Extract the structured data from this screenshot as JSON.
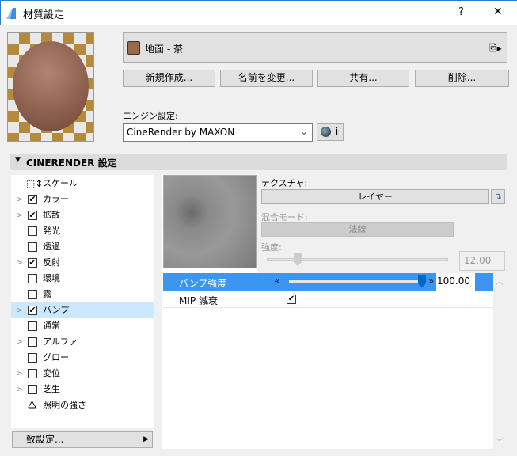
{
  "window": {
    "title": "材質設定",
    "help": "?",
    "close": "✕"
  },
  "material": {
    "name": "地面 - 茶",
    "swatch_color": "#9a6a4f"
  },
  "buttons": {
    "new": "新規作成...",
    "rename": "名前を変更...",
    "share": "共有...",
    "delete": "削除..."
  },
  "engine": {
    "label": "エンジン設定:",
    "value": "CineRender by MAXON",
    "info": "i"
  },
  "section": {
    "title": "CINERENDER 設定"
  },
  "channels": [
    {
      "label": "スケール",
      "type": "scale",
      "chevron": false
    },
    {
      "label": "カラー",
      "checked": true,
      "chevron": true
    },
    {
      "label": "拡散",
      "checked": true,
      "chevron": true
    },
    {
      "label": "発光",
      "checked": false,
      "chevron": false
    },
    {
      "label": "透過",
      "checked": false,
      "chevron": false
    },
    {
      "label": "反射",
      "checked": true,
      "chevron": true
    },
    {
      "label": "環境",
      "checked": false,
      "chevron": false
    },
    {
      "label": "霧",
      "checked": false,
      "chevron": false
    },
    {
      "label": "バンプ",
      "checked": true,
      "chevron": true,
      "selected": true
    },
    {
      "label": "通常",
      "checked": false,
      "chevron": false
    },
    {
      "label": "アルファ",
      "checked": false,
      "chevron": true
    },
    {
      "label": "グロー",
      "checked": false,
      "chevron": false
    },
    {
      "label": "変位",
      "checked": false,
      "chevron": true
    },
    {
      "label": "芝生",
      "checked": false,
      "chevron": true
    },
    {
      "label": "照明の強さ",
      "type": "light",
      "chevron": false
    }
  ],
  "match_button": "一致設定...",
  "detail": {
    "texture_label": "テクスチャ:",
    "texture_value": "レイヤー",
    "blend_label": "混合モード:",
    "blend_value": "法線",
    "strength_label": "強度:",
    "strength_value": "12.00",
    "strength_fraction": 0.15,
    "bump_strength_label": "バンプ強度",
    "bump_strength_value": "100.00",
    "bump_fraction": 1.0,
    "mip_label": "MIP 減衰",
    "mip_checked": true
  },
  "colors": {
    "accent": "#3c96f0",
    "selected_row": "#cce8ff"
  }
}
